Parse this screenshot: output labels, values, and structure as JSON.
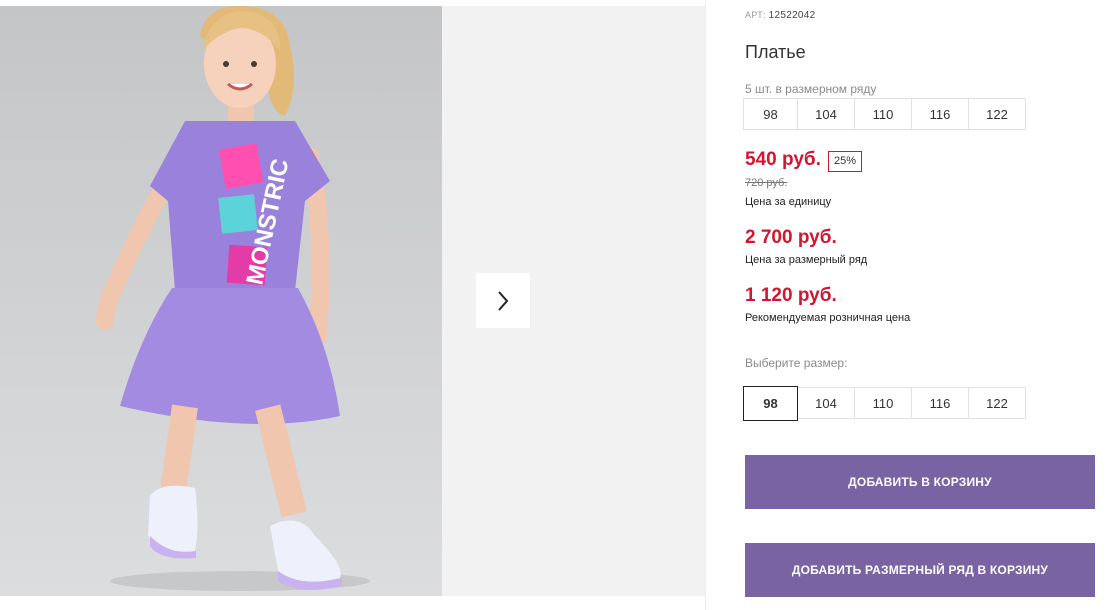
{
  "product": {
    "article_label": "АРТ:",
    "article_number": "12522042",
    "title": "Платье",
    "pack_note": "5 шт. в размерном ряду",
    "pack_sizes": [
      "98",
      "104",
      "110",
      "116",
      "122"
    ],
    "price_unit": "540 руб.",
    "discount_badge": "25%",
    "old_price": "720 руб.",
    "price_unit_caption": "Цена за единицу",
    "price_pack": "2 700 руб.",
    "price_pack_caption": "Цена за размерный ряд",
    "price_retail": "1 120 руб.",
    "price_retail_caption": "Рекомендуемая розничная цена",
    "choose_size_label": "Выберите размер:",
    "sizes": [
      "98",
      "104",
      "110",
      "116",
      "122"
    ],
    "selected_size": "98",
    "add_to_cart": "ДОБАВИТЬ В КОРЗИНУ",
    "add_pack_to_cart": "ДОБАВИТЬ РАЗМЕРНЫЙ РЯД В КОРЗИНУ"
  },
  "gallery": {
    "next_icon": "chevron-right-icon",
    "dress_print_text": "MONSTRIC"
  },
  "colors": {
    "accent_button": "#7a63a3",
    "price_red": "#d3162f",
    "dress": "#9a82dc"
  }
}
